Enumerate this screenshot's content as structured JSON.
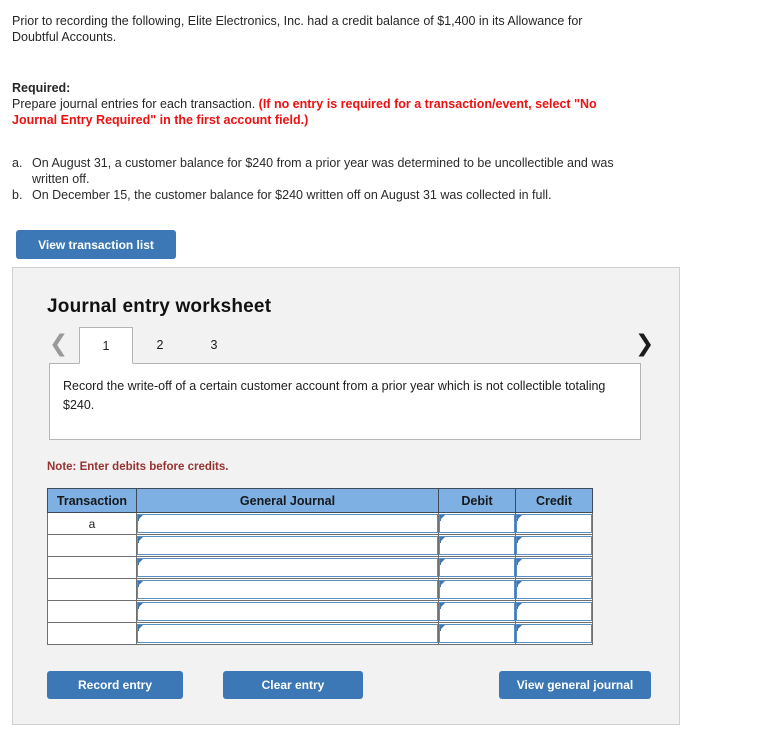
{
  "intro": {
    "text": "Prior to recording the following, Elite Electronics, Inc. had a credit balance of $1,400 in its Allowance for Doubtful Accounts."
  },
  "required": {
    "label": "Required:",
    "text": "Prepare journal entries for each transaction. ",
    "emphasis": "(If no entry is required for a transaction/event, select \"No Journal Entry Required\" in the first account field.)",
    "emphasis_color": "#ee1111"
  },
  "transactions": [
    {
      "letter": "a.",
      "text": "On August 31, a customer balance for $240 from a prior year was determined to be uncollectible and was written off."
    },
    {
      "letter": "b.",
      "text": "On December 15, the customer balance for $240 written off on August 31 was collected in full."
    }
  ],
  "toolbar": {
    "view_transaction_list_label": "View transaction list"
  },
  "worksheet": {
    "title": "Journal entry worksheet",
    "nav": {
      "prev_icon": "chevron-left-icon",
      "next_icon": "chevron-right-icon"
    },
    "tabs": [
      {
        "label": "1",
        "active": true
      },
      {
        "label": "2",
        "active": false
      },
      {
        "label": "3",
        "active": false
      }
    ],
    "instruction": "Record the write-off of a certain customer account from a prior year which is not collectible totaling $240.",
    "note": "Note: Enter debits before credits.",
    "table": {
      "headers": [
        "Transaction",
        "General Journal",
        "Debit",
        "Credit"
      ],
      "header_color": "#7fb0e3",
      "rows": [
        {
          "transaction": "a",
          "general_journal": "",
          "debit": "",
          "credit": ""
        },
        {
          "transaction": "",
          "general_journal": "",
          "debit": "",
          "credit": ""
        },
        {
          "transaction": "",
          "general_journal": "",
          "debit": "",
          "credit": ""
        },
        {
          "transaction": "",
          "general_journal": "",
          "debit": "",
          "credit": ""
        },
        {
          "transaction": "",
          "general_journal": "",
          "debit": "",
          "credit": ""
        },
        {
          "transaction": "",
          "general_journal": "",
          "debit": "",
          "credit": ""
        }
      ]
    },
    "actions": {
      "record_entry_label": "Record entry",
      "clear_entry_label": "Clear entry",
      "view_general_journal_label": "View general journal",
      "button_color": "#3b78b5"
    }
  }
}
